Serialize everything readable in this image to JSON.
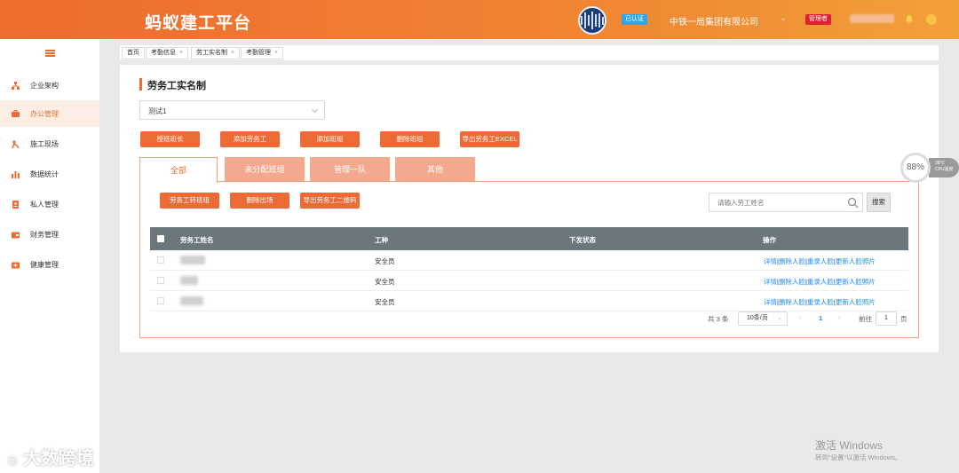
{
  "header": {
    "brand": "蚂蚁建工平台",
    "cert_badge": "已认证",
    "company": "中铁一局集团有限公司",
    "role_badge": "管理者"
  },
  "sidebar": {
    "items": [
      {
        "label": "企业架构",
        "icon": "org-chart-icon"
      },
      {
        "label": "办公管理",
        "icon": "briefcase-icon",
        "active": true
      },
      {
        "label": "施工现场",
        "icon": "worker-icon"
      },
      {
        "label": "数据统计",
        "icon": "bar-chart-icon"
      },
      {
        "label": "私人管理",
        "icon": "person-doc-icon"
      },
      {
        "label": "财务管理",
        "icon": "wallet-icon"
      },
      {
        "label": "健康管理",
        "icon": "medical-kit-icon"
      }
    ]
  },
  "page_tabs": [
    {
      "label": "首页",
      "closable": false
    },
    {
      "label": "考勤信息",
      "closable": true
    },
    {
      "label": "劳工实名制",
      "closable": true
    },
    {
      "label": "考勤管理",
      "closable": true
    }
  ],
  "main": {
    "title": "劳务工实名制",
    "project_select": "测试1",
    "actions": [
      "授班班长",
      "添加劳务工",
      "添加班组",
      "删除班组",
      "导出劳务工EXCEL"
    ],
    "group_tabs": [
      "全部",
      "未分配班组",
      "管理一队",
      "其他"
    ],
    "sub_actions": [
      "劳务工转班组",
      "删除出场",
      "导出劳务工二维码"
    ],
    "search_placeholder": "请输入劳工姓名",
    "search_button": "搜索"
  },
  "table": {
    "headers": [
      "劳务工姓名",
      "工种",
      "下发状态",
      "操作"
    ],
    "rows": [
      {
        "type": "安全员"
      },
      {
        "type": "安全员"
      },
      {
        "type": "安全员"
      }
    ],
    "ops": [
      "详情",
      "删除人脸",
      "重录人脸",
      "更新人脸照片"
    ]
  },
  "pagination": {
    "total": "共 3 条",
    "page_size": "10条/页",
    "current_page": "1",
    "goto_label": "前往",
    "goto_value": "1",
    "page_unit": "页"
  },
  "speed_widget": {
    "value": "88%",
    "line1": "38°C",
    "line2": "CPU温度"
  },
  "watermarks": {
    "brand_logo": "大数跨境",
    "windows_title": "激活 Windows",
    "windows_sub": "转到“设置”以激活 Windows。"
  },
  "colors": {
    "accent": "#ef6a2e",
    "link": "#1890ff",
    "table_header": "#6b767d"
  }
}
